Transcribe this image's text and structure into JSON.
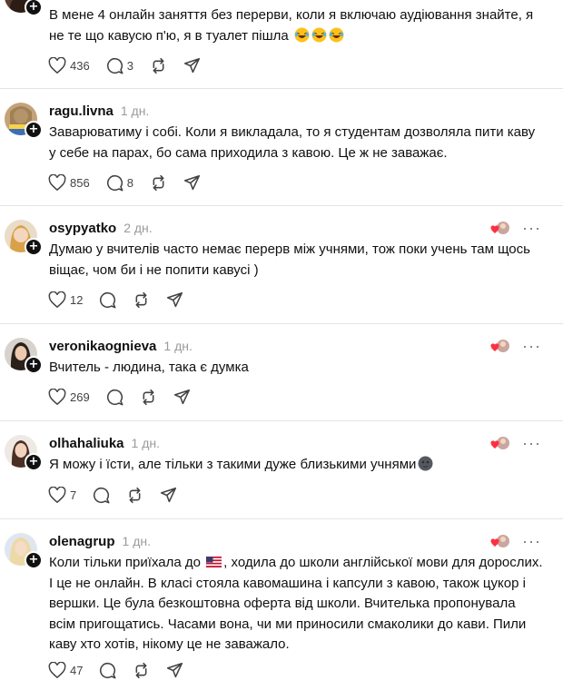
{
  "posts": [
    {
      "username": "",
      "time": "",
      "text": "В мене 4 онлайн заняття без перерви, коли я включаю аудіювання знайте, я не те що кавусю п'ю, я в туалет пішла",
      "likes": "436",
      "comments": "3",
      "emoji": [
        "laughing-tears-emoji",
        "laughing-tears-emoji",
        "laughing-tears-emoji"
      ],
      "author_liked": false
    },
    {
      "username": "ragu.livna",
      "time": "1 дн.",
      "text": "Заварюватиму і собі. Коли я викладала, то я студентам дозволяла пити каву у себе на парах, бо сама приходила з кавою. Це ж не заважає.",
      "likes": "856",
      "comments": "8",
      "author_liked": false
    },
    {
      "username": "osypyatko",
      "time": "2 дн.",
      "text": "Думаю у вчителів часто немає перерв між учнями, тож поки учень там щось віщає, чом би і не попити кавусі )",
      "likes": "12",
      "comments": "",
      "author_liked": true
    },
    {
      "username": "veronikaognieva",
      "time": "1 дн.",
      "text": "Вчитель - людина, така є думка",
      "likes": "269",
      "comments": "",
      "author_liked": true
    },
    {
      "username": "olhahaliuka",
      "time": "1 дн.",
      "text": "Я можу і їсти, але тільки з такими дуже близькими учнями",
      "likes": "7",
      "comments": "",
      "emoji": [
        "new-moon-face-emoji"
      ],
      "author_liked": true
    },
    {
      "username": "olenagrup",
      "time": "1 дн.",
      "text_part1": "Коли тільки приїхала до",
      "text_part2": ", ходила до школи англійської мови для дорослих. І це не онлайн. В класі стояла кавомашина і капсули з кавою, також цукор і вершки. Це була безкоштовна оферта від школи. Вчителька пропонувала всім пригощатись. Часами вона, чи ми приносили смаколики до кави. Пили каву хто хотів, нікому це не заважало.",
      "flag": "us-flag-emoji",
      "likes": "47",
      "comments": "",
      "author_liked": true
    }
  ],
  "icons": {
    "like": "heart-icon",
    "comment": "comment-icon",
    "repost": "repost-icon",
    "share": "send-icon",
    "more": "more-icon"
  },
  "colors": {
    "text": "#101010",
    "muted": "#9a9a9a",
    "divider": "#e4e4e4",
    "heart": "#ff3040"
  }
}
